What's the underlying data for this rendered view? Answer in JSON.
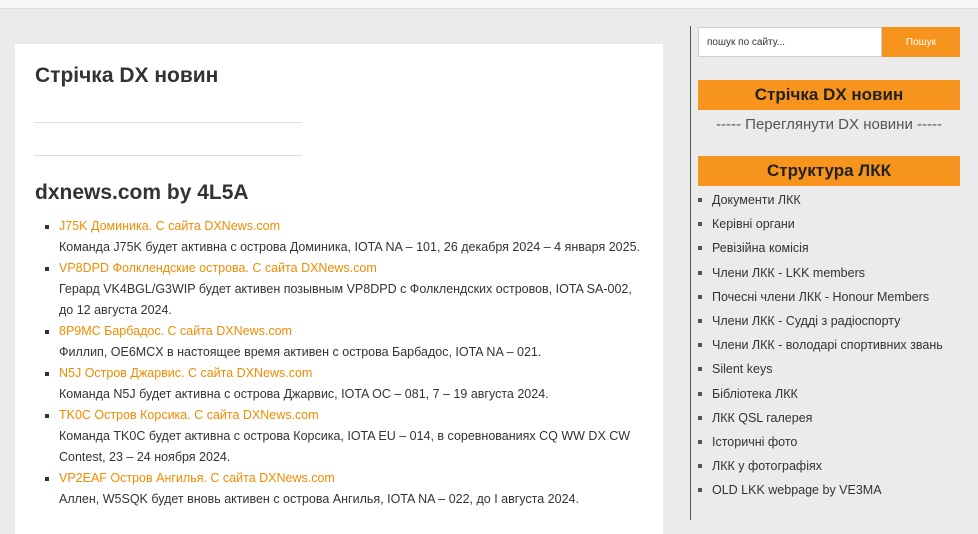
{
  "main": {
    "page_title": "Стрічка DX новин",
    "feed_title": "dxnews.com by 4L5A",
    "news": [
      {
        "link": "J75K Доминика. С сайта DXNews.com",
        "desc": "Команда J75K будет активна с острова Доминика, IOTA NA – 101, 26 декабря 2024 – 4 января 2025."
      },
      {
        "link": "VP8DPD Фолклендские острова. С сайта DXNews.com",
        "desc": "Герард VK4BGL/G3WIP будет активен позывным VP8DPD с Фолклендских островов, IOTA SA-002, до 12 августа 2024."
      },
      {
        "link": "8P9MC Барбадос. С сайта DXNews.com",
        "desc": "Филлип, OE6MCX в настоящее время активен с острова Барбадос, IOTA NA – 021."
      },
      {
        "link": "N5J Остров Джарвис. С сайта DXNews.com",
        "desc": "Команда N5J будет активна с острова Джарвис, IOTA OC – 081, 7 – 19 августа 2024."
      },
      {
        "link": "TK0C Остров Корсика. С сайта DXNews.com",
        "desc": "Команда TK0C будет активна с острова Корсика, IOTA EU – 014, в соревнованиях CQ WW DX CW Contest, 23 – 24 ноября 2024."
      },
      {
        "link": "VP2EAF Остров Ангилья. С сайта DXNews.com",
        "desc": "Аллен, W5SQK будет вновь активен с острова Ангилья, IOTA NA – 022, до I августа 2024."
      }
    ]
  },
  "sidebar": {
    "search_placeholder": "пошук по сайту...",
    "search_button": "Пошук",
    "heading_dx": "Стрічка DX новин",
    "view_dx": "----- Переглянути DX новини -----",
    "heading_structure": "Структура ЛКК",
    "menu": [
      "Документи ЛКК",
      "Керівні органи",
      "Ревізійна комісія",
      "Члени ЛКК - LKK members",
      "Почесні члени ЛКК - Honour Members",
      "Члени ЛКК - Судді з радіоспорту",
      "Члени ЛКК - володарі спортивних звань",
      "Silent keys",
      "Бібліотека ЛКК",
      "ЛКК QSL галерея",
      "Історичні фото",
      "ЛКК у фотографіях",
      "OLD LKK webpage by VE3MA"
    ]
  },
  "colors": {
    "accent": "#f7941d",
    "link": "#f28b00"
  }
}
